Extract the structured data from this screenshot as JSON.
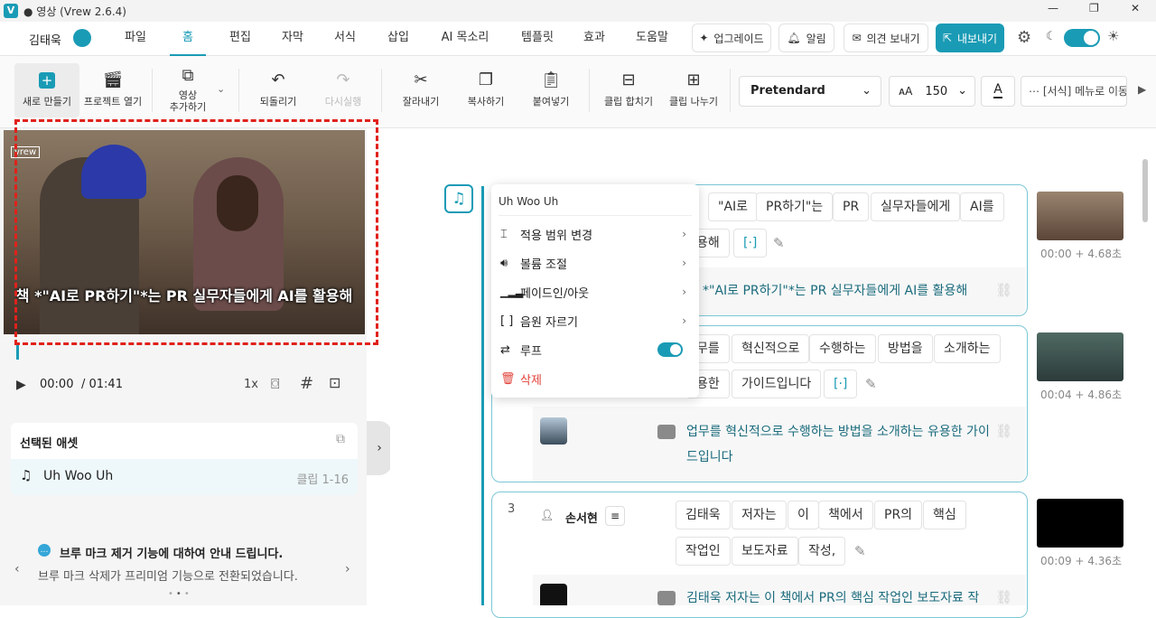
{
  "titlebar": {
    "title": "● 영상 (Vrew 2.6.4)",
    "logo": "V"
  },
  "menubar": {
    "user": "김태욱",
    "tabs": [
      "파일",
      "홈",
      "편집",
      "자막",
      "서식",
      "삽입",
      "AI 목소리",
      "템플릿",
      "효과",
      "도움말"
    ],
    "active": "홈",
    "upgrade": "업그레이드",
    "alarm": "알림",
    "feedback": "의견 보내기",
    "export": "내보내기"
  },
  "toolbar": {
    "new": "새로 만들기",
    "open": "프로젝트 열기",
    "add_video": "영상\n추가하기",
    "undo": "되돌리기",
    "redo": "다시실행",
    "cut": "잘라내기",
    "copy": "복사하기",
    "paste": "붙여넣기",
    "merge": "클립 합치기",
    "split": "클립 나누기",
    "font": "Pretendard",
    "font_size": "150",
    "format_menu": "[서식] 메뉴로 이동"
  },
  "player": {
    "watermark": "vrew",
    "subtitle": "책 *\"AI로 PR하기\"*는 PR 실무자들에게 AI를 활용해",
    "time": "00:00",
    "duration": "/ 01:41",
    "speed": "1x"
  },
  "asset": {
    "header": "선택된 애셋",
    "name": "Uh Woo Uh",
    "clip": "클립 1-16"
  },
  "notice": {
    "title": "브루 마크 제거 기능에 대하여 안내 드립니다.",
    "body": "브루 마크 삭제가 프리미엄 기능으로 전환되었습니다."
  },
  "popup": {
    "title": "Uh Woo Uh",
    "items": [
      "적용 범위 변경",
      "볼륨 조절",
      "페이드인/아웃",
      "음원 자르기",
      "루프",
      "삭제"
    ]
  },
  "clip1": {
    "chips1": [
      "\"AI로",
      "PR하기\"는",
      "PR",
      "실무자들에게",
      "AI를"
    ],
    "chips2": [
      "용해",
      "[·]"
    ],
    "caption": "*\"AI로 PR하기\"*는 PR 실무자들에게 AI를 활용해",
    "ts": "00:00 + 4.68초"
  },
  "clip2": {
    "chips1": [
      "무를",
      "혁신적으로",
      "수행하는",
      "방법을",
      "소개하는"
    ],
    "chips2": [
      "용한",
      "가이드입니다",
      "[·]"
    ],
    "caption": "업무를 혁신적으로 수행하는 방법을 소개하는 유용한 가이",
    "caption2": "드입니다",
    "ts": "00:04 + 4.86초"
  },
  "clip3": {
    "num": "3",
    "speaker": "손서현",
    "chips1": [
      "김태욱",
      "저자는",
      "이",
      "책에서",
      "PR의",
      "핵심"
    ],
    "chips2": [
      "작업인",
      "보도자료",
      "작성,"
    ],
    "caption": "김태욱 저자는 이 책에서 PR의 핵심 작업인 보도자료 작",
    "ts": "00:09 + 4.36초"
  },
  "colors": {
    "accent": "#1a9bb5",
    "danger": "#e0211b"
  }
}
